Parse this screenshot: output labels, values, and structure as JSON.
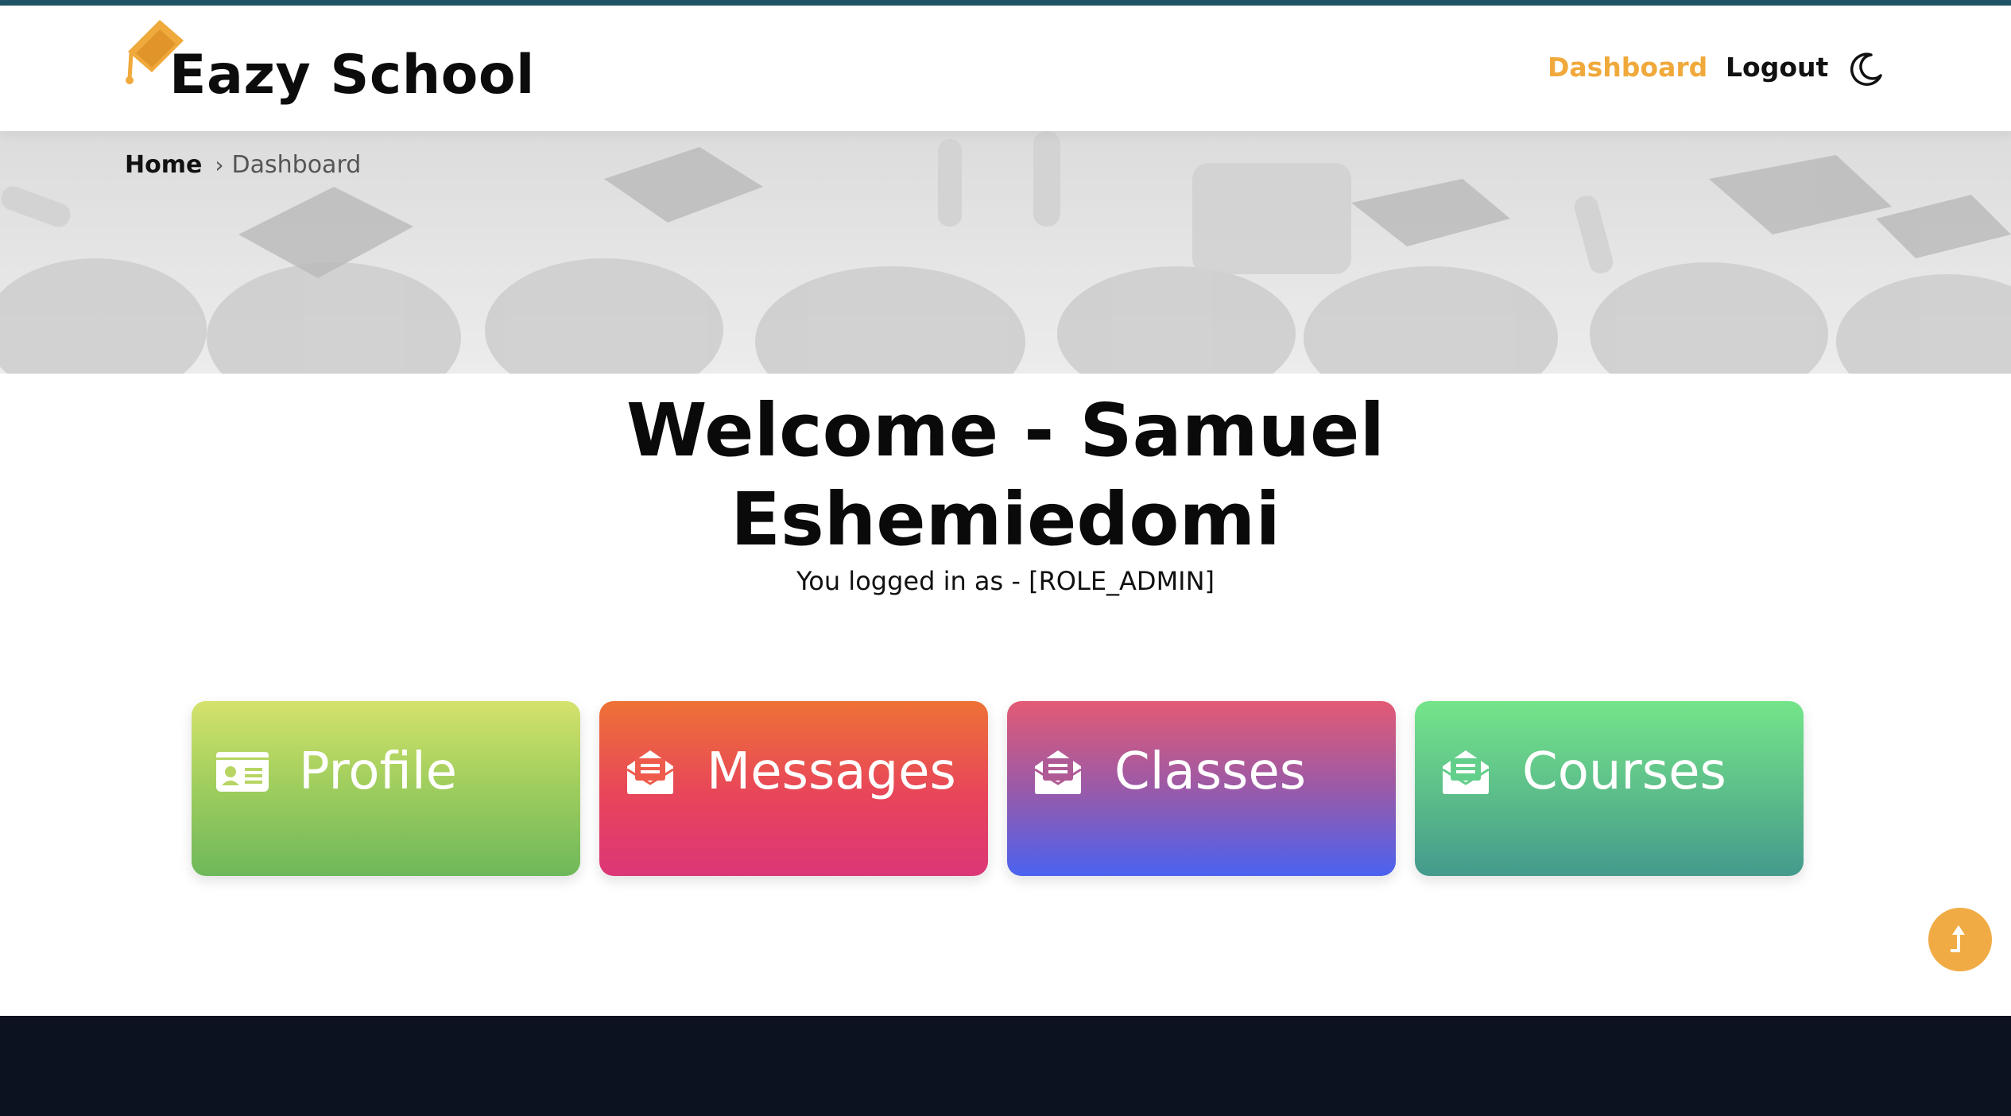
{
  "brand": {
    "name": "Eazy School",
    "cap_icon": "graduation-cap-icon",
    "accent_color": "#f0a93b"
  },
  "nav": {
    "dashboard": "Dashboard",
    "logout": "Logout",
    "theme_icon": "moon-icon"
  },
  "breadcrumb": {
    "home": "Home",
    "separator": "›",
    "current": "Dashboard"
  },
  "welcome": {
    "line1": "Welcome - Samuel",
    "line2": "Eshemiedomi",
    "role": "You logged in as - [ROLE_ADMIN]"
  },
  "cards": [
    {
      "label": "Profile",
      "icon": "id-card-icon"
    },
    {
      "label": "Messages",
      "icon": "envelope-open-icon"
    },
    {
      "label": "Classes",
      "icon": "envelope-open-icon"
    },
    {
      "label": "Courses",
      "icon": "envelope-open-icon"
    }
  ],
  "scroll_top": {
    "icon": "arrow-up-icon",
    "color": "#f1ab45"
  },
  "footer": {
    "color": "#0c1220"
  }
}
